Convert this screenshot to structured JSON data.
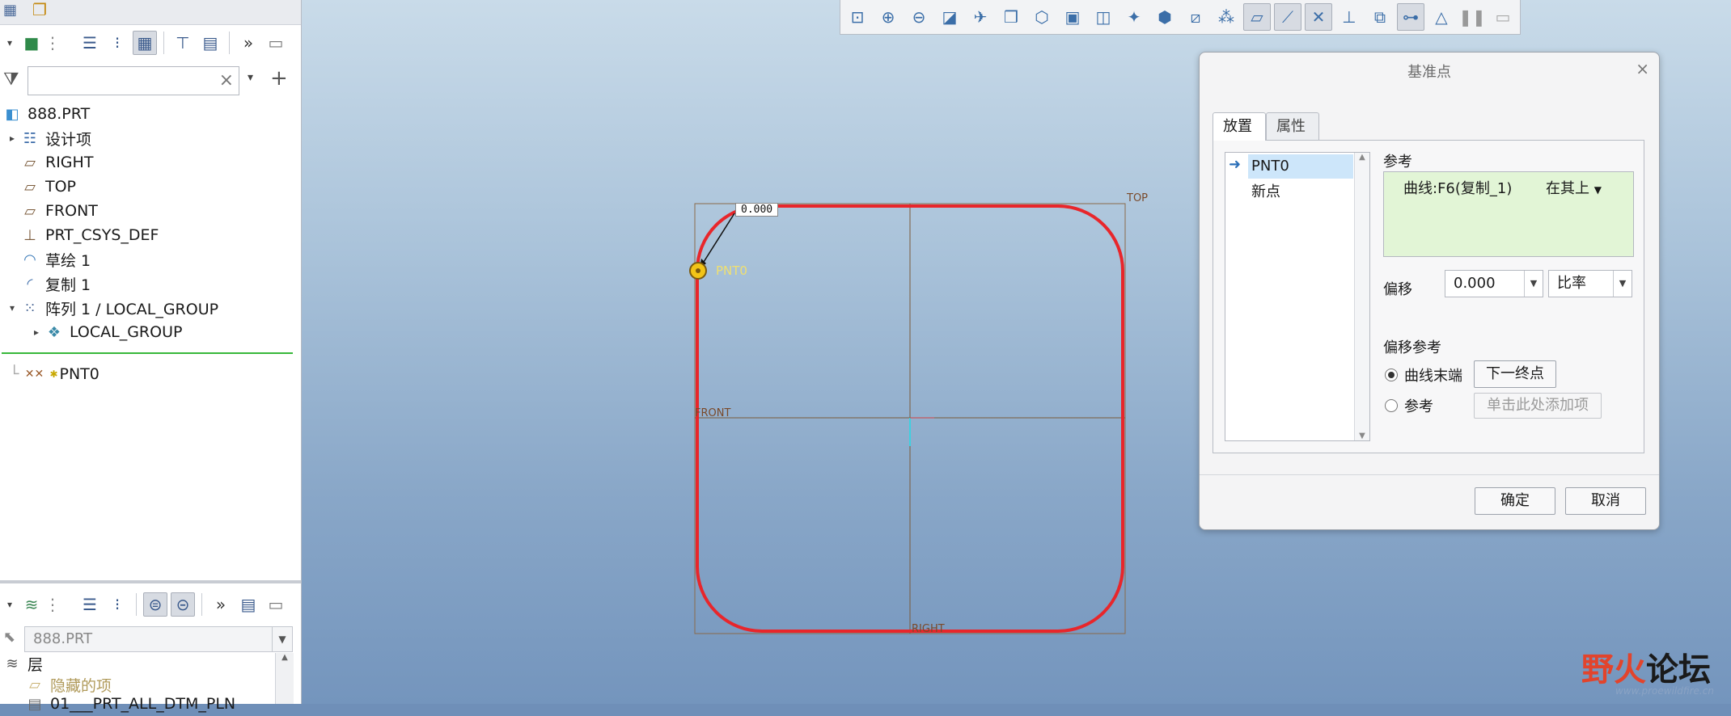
{
  "left_panel": {
    "model_tree": [
      {
        "label": "888.PRT",
        "icon": "part-icon",
        "indent": 0,
        "twisty": ""
      },
      {
        "label": "设计项",
        "icon": "design-items-icon",
        "indent": 1,
        "twisty": "▸"
      },
      {
        "label": "RIGHT",
        "icon": "datum-plane-icon",
        "indent": 1,
        "twisty": ""
      },
      {
        "label": "TOP",
        "icon": "datum-plane-icon",
        "indent": 1,
        "twisty": ""
      },
      {
        "label": "FRONT",
        "icon": "datum-plane-icon",
        "indent": 1,
        "twisty": ""
      },
      {
        "label": "PRT_CSYS_DEF",
        "icon": "csys-icon",
        "indent": 1,
        "twisty": ""
      },
      {
        "label": "草绘 1",
        "icon": "sketch-icon",
        "indent": 1,
        "twisty": ""
      },
      {
        "label": "复制 1",
        "icon": "copy-icon",
        "indent": 1,
        "twisty": ""
      },
      {
        "label": "阵列 1 / LOCAL_GROUP",
        "icon": "pattern-icon",
        "indent": 1,
        "twisty": "▾"
      },
      {
        "label": "LOCAL_GROUP",
        "icon": "group-icon",
        "indent": 2,
        "twisty": "▸"
      }
    ],
    "insert_item": {
      "label": "PNT0",
      "icon": "datum-point-icon"
    },
    "layer_combo_value": "888.PRT",
    "layers_header": "层",
    "layers": [
      {
        "label": "隐藏的项"
      },
      {
        "label": "01___PRT_ALL_DTM_PLN"
      }
    ]
  },
  "viewport": {
    "point_label": "PNT0",
    "dimension_value": "0.000",
    "plane_labels": {
      "top": "TOP",
      "front": "FRONT",
      "right": "RIGHT"
    }
  },
  "dialog": {
    "title": "基准点",
    "close": "×",
    "tabs": [
      "放置",
      "属性"
    ],
    "points": [
      "PNT0",
      "新点"
    ],
    "reference_label": "参考",
    "reference_value": "曲线:F6(复制_1)",
    "reference_mode": "在其上",
    "offset_label": "偏移",
    "offset_value": "0.000",
    "offset_type": "比率",
    "offset_ref_label": "偏移参考",
    "radio_curve_end": "曲线末端",
    "btn_next_end": "下一终点",
    "radio_reference": "参考",
    "btn_add_item": "单击此处添加项",
    "ok": "确定",
    "cancel": "取消"
  },
  "watermark": {
    "text_red": "野火",
    "text_black": "论坛",
    "url": "www.proewildfire.cn"
  },
  "colors": {
    "curve": "#e8262b",
    "point": "#f2c417",
    "selection": "#cde6fa",
    "reference_bg": "#e2f5d6"
  }
}
